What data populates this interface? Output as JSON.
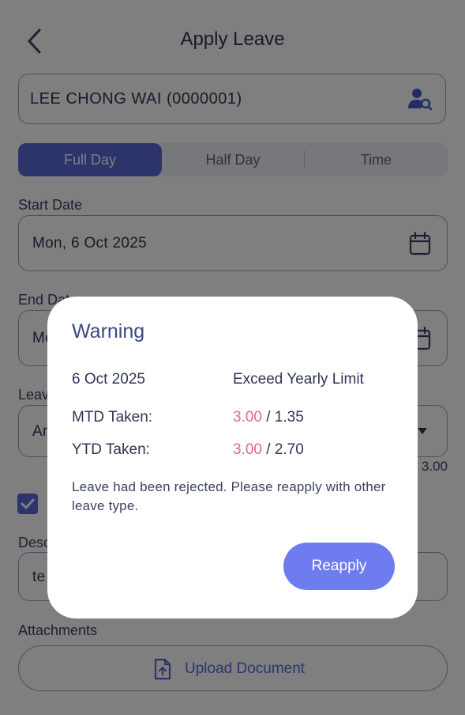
{
  "header": {
    "title": "Apply Leave"
  },
  "employee": {
    "name": "LEE CHONG WAI (0000001)"
  },
  "day_type_tabs": [
    {
      "label": "Full Day"
    },
    {
      "label": "Half Day"
    },
    {
      "label": "Time"
    }
  ],
  "start_date": {
    "label": "Start Date",
    "value": "Mon, 6 Oct 2025"
  },
  "end_date": {
    "label": "End Date",
    "value": "Mo"
  },
  "leave_type": {
    "label": "Leav",
    "value": "An"
  },
  "balance_text": "3.00",
  "description": {
    "label": "Desc",
    "value": "te"
  },
  "attachments": {
    "label": "Attachments",
    "upload_label": "Upload Document"
  },
  "dialog": {
    "title": "Warning",
    "date": "6 Oct 2025",
    "reason": "Exceed Yearly Limit",
    "mtd": {
      "label": "MTD Taken:",
      "taken": "3.00",
      "limit": " / 1.35"
    },
    "ytd": {
      "label": "YTD Taken:",
      "taken": "3.00",
      "limit": " / 2.70"
    },
    "message": "Leave had been rejected. Please reapply with other leave type.",
    "button_label": "Reapply"
  },
  "colors": {
    "accent": "#5b68d6",
    "button": "#6f7cf0",
    "exceeded": "#e46a7c",
    "overlay": "rgba(0,0,0,0.5)"
  },
  "icons": {
    "back": "chevron-left-icon",
    "employee_search": "user-search-icon",
    "calendar": "calendar-icon",
    "dropdown": "caret-down-icon",
    "checkbox": "checkmark-icon",
    "upload": "file-upload-icon"
  }
}
